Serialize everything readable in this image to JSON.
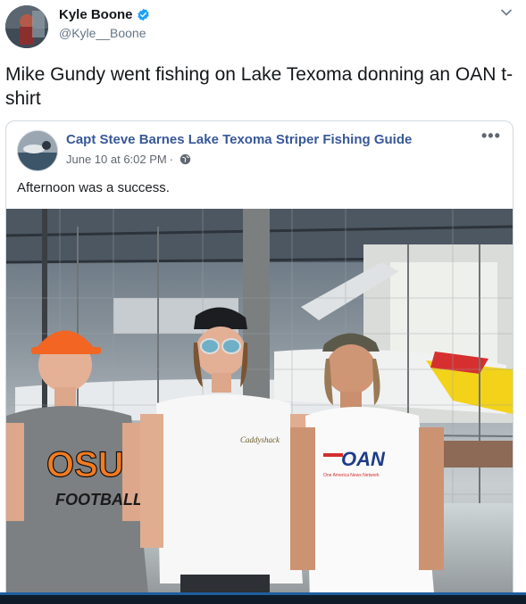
{
  "tweet": {
    "author_name": "Kyle Boone",
    "author_handle": "@Kyle__Boone",
    "text": "Mike Gundy went fishing on Lake Texoma donning an OAN t-shirt",
    "verified": true
  },
  "embedded_post": {
    "page_name": "Capt Steve Barnes Lake Texoma Striper Fishing Guide",
    "timestamp": "June 10 at 6:02 PM",
    "separator": "·",
    "text": "Afternoon was a success.",
    "more_label": "•••",
    "photo": {
      "shirt_left": "OSU",
      "shirt_left_sub": "FOOTBALL",
      "shirt_right": "OAN",
      "shirt_right_sub": "One America News Network",
      "shirt_middle": "Caddyshack"
    }
  },
  "colors": {
    "verified": "#1da1f2",
    "fb_link": "#385898",
    "osu_orange": "#f47b20"
  }
}
